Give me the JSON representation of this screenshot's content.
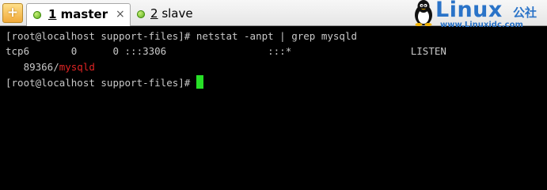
{
  "tabbar": {
    "new_tab_symbol": "+",
    "tabs": [
      {
        "number": "1",
        "label": "master",
        "close": "×"
      },
      {
        "number": "2",
        "label": "slave"
      }
    ]
  },
  "logo": {
    "word": "Linux",
    "cn": "公社",
    "url": "www.Linuxidc.com"
  },
  "terminal": {
    "line1": "[root@localhost support-files]# netstat -anpt | grep mysqld",
    "line2": "tcp6       0      0 :::3306                 :::*                    LISTEN",
    "line3_pid": "   89366/",
    "line3_proc": "mysqld",
    "line4": "[root@localhost support-files]# "
  },
  "colors": {
    "terminal_bg": "#000000",
    "text": "#c8c8c8",
    "highlight": "#e02424",
    "cursor": "#27e027"
  }
}
